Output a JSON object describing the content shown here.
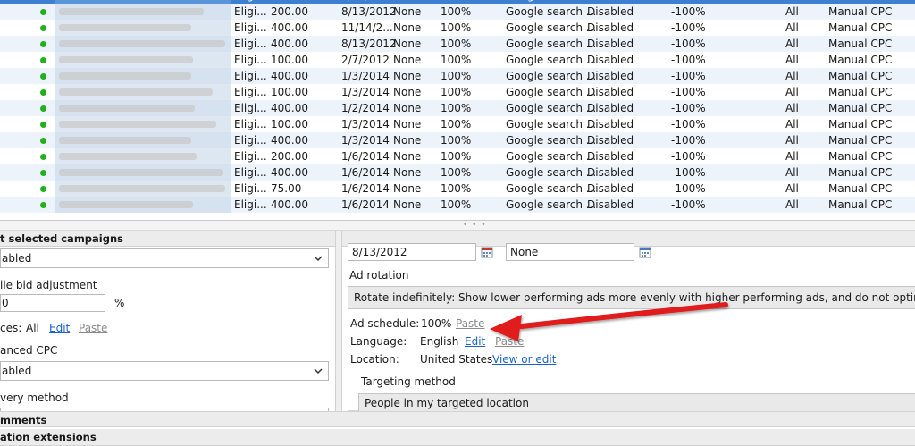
{
  "grid": {
    "rows": [
      {
        "status": "Eligi...",
        "budget": "200.00",
        "start": "8/13/2012",
        "end": "None",
        "adsched": "100%",
        "network": "Google search ...",
        "dsa": "Disabled",
        "mobile": "-100%",
        "devices": "All",
        "bidding": "Manual CPC",
        "selected": true
      },
      {
        "status": "Eligi...",
        "budget": "200.00",
        "start": "8/13/2012",
        "end": "None",
        "adsched": "100%",
        "network": "Google search ...",
        "dsa": "Disabled",
        "mobile": "-100%",
        "devices": "All",
        "bidding": "Manual CPC"
      },
      {
        "status": "Eligi...",
        "budget": "400.00",
        "start": "11/14/2...",
        "end": "None",
        "adsched": "100%",
        "network": "Google search ...",
        "dsa": "Disabled",
        "mobile": "-100%",
        "devices": "All",
        "bidding": "Manual CPC"
      },
      {
        "status": "Eligi...",
        "budget": "400.00",
        "start": "8/13/2012",
        "end": "None",
        "adsched": "100%",
        "network": "Google search ...",
        "dsa": "Disabled",
        "mobile": "-100%",
        "devices": "All",
        "bidding": "Manual CPC"
      },
      {
        "status": "Eligi...",
        "budget": "100.00",
        "start": "2/7/2012",
        "end": "None",
        "adsched": "100%",
        "network": "Google search ...",
        "dsa": "Disabled",
        "mobile": "-100%",
        "devices": "All",
        "bidding": "Manual CPC"
      },
      {
        "status": "Eligi...",
        "budget": "400.00",
        "start": "1/3/2014",
        "end": "None",
        "adsched": "100%",
        "network": "Google search ...",
        "dsa": "Disabled",
        "mobile": "-100%",
        "devices": "All",
        "bidding": "Manual CPC"
      },
      {
        "status": "Eligi...",
        "budget": "100.00",
        "start": "1/3/2014",
        "end": "None",
        "adsched": "100%",
        "network": "Google search ...",
        "dsa": "Disabled",
        "mobile": "-100%",
        "devices": "All",
        "bidding": "Manual CPC"
      },
      {
        "status": "Eligi...",
        "budget": "400.00",
        "start": "1/2/2014",
        "end": "None",
        "adsched": "100%",
        "network": "Google search ...",
        "dsa": "Disabled",
        "mobile": "-100%",
        "devices": "All",
        "bidding": "Manual CPC"
      },
      {
        "status": "Eligi...",
        "budget": "100.00",
        "start": "1/3/2014",
        "end": "None",
        "adsched": "100%",
        "network": "Google search ...",
        "dsa": "Disabled",
        "mobile": "-100%",
        "devices": "All",
        "bidding": "Manual CPC"
      },
      {
        "status": "Eligi...",
        "budget": "400.00",
        "start": "1/3/2014",
        "end": "None",
        "adsched": "100%",
        "network": "Google search ...",
        "dsa": "Disabled",
        "mobile": "-100%",
        "devices": "All",
        "bidding": "Manual CPC"
      },
      {
        "status": "Eligi...",
        "budget": "200.00",
        "start": "1/6/2014",
        "end": "None",
        "adsched": "100%",
        "network": "Google search ...",
        "dsa": "Disabled",
        "mobile": "-100%",
        "devices": "All",
        "bidding": "Manual CPC"
      },
      {
        "status": "Eligi...",
        "budget": "400.00",
        "start": "1/6/2014",
        "end": "None",
        "adsched": "100%",
        "network": "Google search ...",
        "dsa": "Disabled",
        "mobile": "-100%",
        "devices": "All",
        "bidding": "Manual CPC"
      },
      {
        "status": "Eligi...",
        "budget": "75.00",
        "start": "1/6/2014",
        "end": "None",
        "adsched": "100%",
        "network": "Google search ...",
        "dsa": "Disabled",
        "mobile": "-100%",
        "devices": "All",
        "bidding": "Manual CPC"
      },
      {
        "status": "Eligi...",
        "budget": "400.00",
        "start": "1/6/2014",
        "end": "None",
        "adsched": "100%",
        "network": "Google search ...",
        "dsa": "Disabled",
        "mobile": "-100%",
        "devices": "All",
        "bidding": "Manual CPC"
      }
    ]
  },
  "edit_panel": {
    "header": "t selected campaigns",
    "status_value": "abled",
    "mobile_label": "ile bid adjustment",
    "mobile_value": "0",
    "mobile_unit": "%",
    "devices_label": "ces:",
    "devices_value": "All",
    "devices_edit": "Edit",
    "devices_paste": "Paste",
    "ecpc_label": "anced CPC",
    "ecpc_value": "abled",
    "delivery_label": "very method",
    "comments_section": "mments",
    "location_ext_section": "ation extensions"
  },
  "right_panel": {
    "start_date": "8/13/2012",
    "end_date": "None",
    "ad_rotation_label": "Ad rotation",
    "ad_rotation_value": "Rotate indefinitely: Show lower performing ads more evenly with higher performing ads, and do not optimize",
    "ad_schedule_label": "Ad schedule:",
    "ad_schedule_value": "100%",
    "ad_schedule_paste": "Paste",
    "language_label": "Language:",
    "language_value": "English",
    "language_edit": "Edit",
    "language_paste": "Paste",
    "location_label": "Location:",
    "location_value": "United States",
    "location_link": "View or edit",
    "targeting_label": "Targeting method",
    "targeting_value": "People in my targeted location"
  },
  "colors": {
    "selection": "#3d7fd1",
    "status_dot": "#21b11d",
    "link": "#1a62c6",
    "arrow": "#e01e1e"
  }
}
